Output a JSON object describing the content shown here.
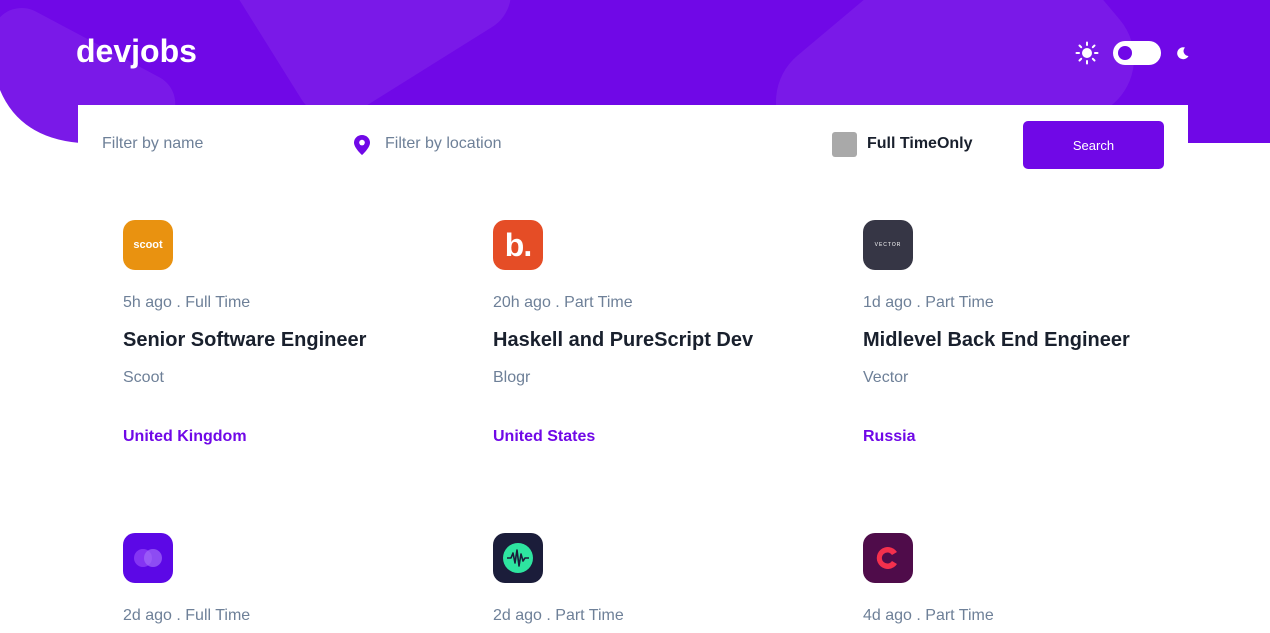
{
  "header": {
    "logo": "devjobs",
    "colors": {
      "primary": "#7008e7",
      "dark_text": "#19202d",
      "muted_text": "#6e8098"
    }
  },
  "theme": {
    "sun_icon": "sun-icon",
    "moon_icon": "moon-icon",
    "mode": "light"
  },
  "search": {
    "name_placeholder": "Filter by name",
    "location_placeholder": "Filter by location",
    "location_icon": "location-pin-icon",
    "fulltime_label": "Full TimeOnly",
    "fulltime_checked": false,
    "button_label": "Search"
  },
  "jobs": [
    {
      "logo_text": "scoot",
      "logo_color": "#e99210",
      "posted": "5h ago",
      "contract": "Full Time",
      "meta": "5h ago . Full Time",
      "position": "Senior Software Engineer",
      "company": "Scoot",
      "location": "United Kingdom"
    },
    {
      "logo_text": "b.",
      "logo_color": "#e54d26",
      "posted": "20h ago",
      "contract": "Part Time",
      "meta": "20h ago . Part Time",
      "position": "Haskell and PureScript Dev",
      "company": "Blogr",
      "location": "United States"
    },
    {
      "logo_text": "VECTOR",
      "logo_color": "#363645",
      "posted": "1d ago",
      "contract": "Part Time",
      "meta": "1d ago . Part Time",
      "position": "Midlevel Back End Engineer",
      "company": "Vector",
      "location": "Russia"
    },
    {
      "logo_text": "",
      "logo_color": "#5c08e6",
      "posted": "2d ago",
      "contract": "Full Time",
      "meta": "2d ago . Full Time"
    },
    {
      "logo_text": "",
      "logo_color": "#1b1d3a",
      "posted": "2d ago",
      "contract": "Part Time",
      "meta": "2d ago . Part Time"
    },
    {
      "logo_text": "",
      "logo_color": "#4f0c4a",
      "posted": "4d ago",
      "contract": "Part Time",
      "meta": "4d ago . Part Time"
    }
  ]
}
